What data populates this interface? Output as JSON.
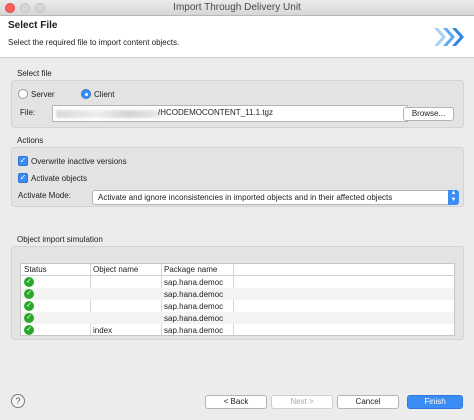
{
  "window": {
    "title": "Import Through Delivery Unit"
  },
  "header": {
    "title": "Select File",
    "description": "Select the required file to import content objects."
  },
  "select_file": {
    "title": "Select file",
    "options": [
      "Server",
      "Client"
    ],
    "selected": "Client",
    "file_label": "File:",
    "file_value_visible": "/HCODEMOCONTENT_11.1.tgz",
    "browse_label": "Browse..."
  },
  "actions": {
    "title": "Actions",
    "overwrite_label": "Overwrite inactive versions",
    "overwrite_checked": true,
    "activate_label": "Activate objects",
    "activate_checked": true,
    "mode_label": "Activate Mode:",
    "mode_value": "Activate and ignore inconsistencies in imported objects and in their affected objects"
  },
  "simulation": {
    "title": "Object import simulation",
    "columns": [
      "Status",
      "Object name",
      "Package name"
    ],
    "rows": [
      {
        "status": "ok",
        "object_name": "",
        "package_name": "sap.hana.democ"
      },
      {
        "status": "ok",
        "object_name": "",
        "package_name": "sap.hana.democ"
      },
      {
        "status": "ok",
        "object_name": "",
        "package_name": "sap.hana.democ"
      },
      {
        "status": "ok",
        "object_name": "",
        "package_name": "sap.hana.democ"
      },
      {
        "status": "ok",
        "object_name": "index",
        "package_name": "sap.hana.democ"
      }
    ]
  },
  "footer": {
    "help_symbol": "?",
    "back_label": "< Back",
    "next_label": "Next >",
    "cancel_label": "Cancel",
    "finish_label": "Finish"
  },
  "colors": {
    "accent": "#3b8df5",
    "success": "#2aa82a",
    "close": "#fc5f57"
  },
  "icons": {
    "wizard": "wizard-chevron-icon",
    "status": "check-circle-icon",
    "help": "help-icon"
  }
}
